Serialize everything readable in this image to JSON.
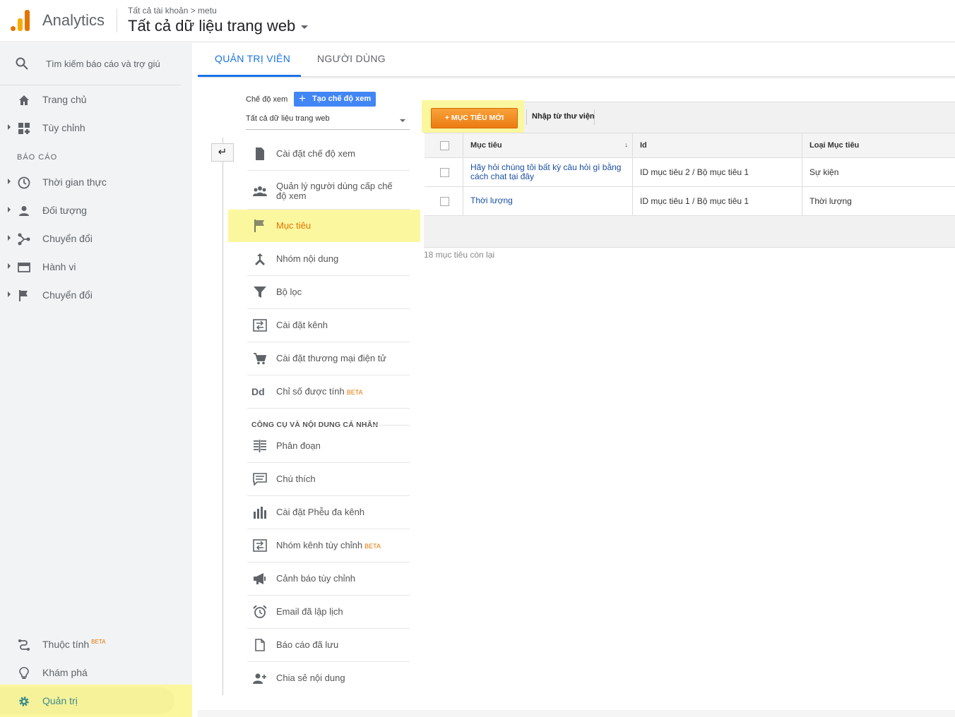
{
  "header": {
    "app_name": "Analytics",
    "breadcrumb": "Tất cả tài khoản > metu",
    "property": "Tất cả dữ liệu trang web"
  },
  "sidebar": {
    "search_placeholder": "Tìm kiếm báo cáo và trợ giúp",
    "section_label": "BÁO CÁO",
    "top_items": [
      {
        "label": "Trang chủ",
        "icon": "home-icon"
      },
      {
        "label": "Tùy chỉnh",
        "icon": "dashboard-icon"
      }
    ],
    "report_items": [
      {
        "label": "Thời gian thực",
        "icon": "clock-icon"
      },
      {
        "label": "Đối tượng",
        "icon": "person-icon"
      },
      {
        "label": "Chuyển đổi",
        "icon": "acquisition-icon"
      },
      {
        "label": "Hành vi",
        "icon": "behavior-icon"
      },
      {
        "label": "Chuyển đổi",
        "icon": "flag-icon"
      }
    ],
    "bottom_items": [
      {
        "label": "Thuộc tính",
        "icon": "attribution-icon",
        "badge": "BETA"
      },
      {
        "label": "Khám phá",
        "icon": "lightbulb-icon"
      },
      {
        "label": "Quản trị",
        "icon": "gear-icon"
      }
    ]
  },
  "tabs": [
    {
      "label": "QUẢN TRỊ VIÊN",
      "active": true
    },
    {
      "label": "NGƯỜI DÙNG",
      "active": false
    }
  ],
  "view": {
    "label": "Chế độ xem",
    "create_button": "Tạo chế độ xem",
    "selected": "Tất cả dữ liệu trang web"
  },
  "admin_menu": [
    {
      "label": "Cài đặt chế độ xem",
      "icon": "document-icon"
    },
    {
      "label": "Quản lý người dùng cấp chế độ xem",
      "icon": "users-icon"
    },
    {
      "label": "Mục tiêu",
      "icon": "flag-icon",
      "active": true
    },
    {
      "label": "Nhóm nội dung",
      "icon": "merge-icon"
    },
    {
      "label": "Bộ lọc",
      "icon": "filter-icon"
    },
    {
      "label": "Cài đặt kênh",
      "icon": "channel-icon"
    },
    {
      "label": "Cài đặt thương mại điện tử",
      "icon": "cart-icon"
    },
    {
      "label": "Chỉ số được tính",
      "icon": "dd-icon",
      "badge": "BETA"
    }
  ],
  "personal_label": "CÔNG CỤ VÀ NỘI DUNG CÁ NHÂN",
  "personal_menu": [
    {
      "label": "Phân đoạn",
      "icon": "segments-icon"
    },
    {
      "label": "Chú thích",
      "icon": "comment-icon"
    },
    {
      "label": "Cài đặt Phễu đa kênh",
      "icon": "bar-chart-icon"
    },
    {
      "label": "Nhóm kênh tùy chỉnh",
      "icon": "channel-icon",
      "badge": "BETA"
    },
    {
      "label": "Cảnh báo tùy chỉnh",
      "icon": "megaphone-icon"
    },
    {
      "label": "Email đã lập lịch",
      "icon": "alarm-icon"
    },
    {
      "label": "Báo cáo đã lưu",
      "icon": "report-icon"
    },
    {
      "label": "Chia sẻ nội dung",
      "icon": "share-person-icon"
    }
  ],
  "goals": {
    "new_goal_button": "+ MỤC TIÊU MỚI",
    "import_button": "Nhập từ thư viện",
    "columns": [
      "Mục tiêu",
      "Id",
      "Loại Mục tiêu"
    ],
    "rows": [
      {
        "name": "Hãy hỏi chúng tôi bất kỳ câu hỏi gì bằng cách chat tại đây",
        "id": "ID mục tiêu 2 / Bộ mục tiêu 1",
        "type": "Sự kiện"
      },
      {
        "name": "Thời lượng",
        "id": "ID mục tiêu 1 / Bộ mục tiêu 1",
        "type": "Thời lượng"
      }
    ],
    "remaining": "18 mục tiêu còn lại"
  },
  "colors": {
    "accent_blue": "#1a73e8",
    "orange": "#e37400",
    "highlight": "#fbf79f"
  }
}
